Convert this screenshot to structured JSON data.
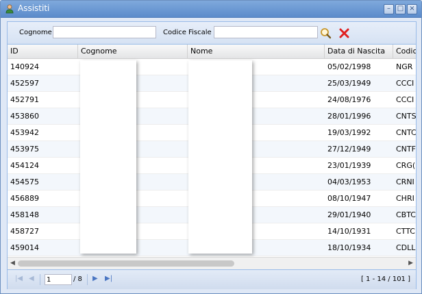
{
  "window": {
    "title": "Assistiti",
    "buttons": [
      "–",
      "□",
      "×"
    ]
  },
  "search": {
    "cognome_label": "Cognome",
    "cognome_value": "",
    "codice_label": "Codice Fiscale",
    "codice_value": ""
  },
  "grid": {
    "columns": [
      "ID",
      "Cognome",
      "Nome",
      "Data di Nascita",
      "Codic"
    ],
    "rows": [
      {
        "id": "140924",
        "dob": "05/02/1998",
        "cf": "NGR"
      },
      {
        "id": "452597",
        "dob": "25/03/1949",
        "cf": "CCCI"
      },
      {
        "id": "452791",
        "dob": "24/08/1976",
        "cf": "CCCI"
      },
      {
        "id": "453860",
        "dob": "28/01/1996",
        "cf": "CNTS"
      },
      {
        "id": "453942",
        "dob": "19/03/1992",
        "cf": "CNTC"
      },
      {
        "id": "453975",
        "dob": "27/12/1949",
        "cf": "CNTF"
      },
      {
        "id": "454124",
        "dob": "23/01/1939",
        "cf": "CRG("
      },
      {
        "id": "454575",
        "dob": "04/03/1953",
        "cf": "CRNI"
      },
      {
        "id": "456889",
        "dob": "08/10/1947",
        "cf": "CHRI"
      },
      {
        "id": "458148",
        "dob": "29/01/1940",
        "cf": "CBTC"
      },
      {
        "id": "458727",
        "dob": "14/10/1931",
        "cf": "CTTC"
      },
      {
        "id": "459014",
        "dob": "18/10/1934",
        "cf": "CDLL"
      }
    ]
  },
  "pager": {
    "page": "1",
    "total": "/ 8",
    "info": "[ 1 - 14 / 101 ]"
  },
  "colors": {
    "titlebar": "#5b8bcb",
    "accent": "#99bbe8",
    "clear_icon": "#e02020"
  },
  "icons": [
    "user-icon",
    "search-icon",
    "clear-icon",
    "first-page-icon",
    "prev-page-icon",
    "next-page-icon",
    "last-page-icon"
  ]
}
